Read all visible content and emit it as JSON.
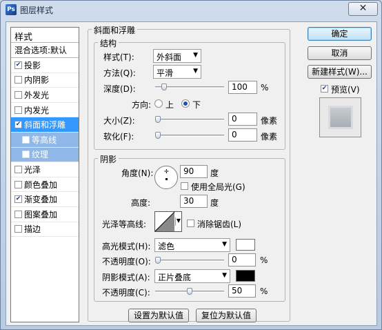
{
  "window": {
    "title": "图层样式",
    "close_symbol": "✕"
  },
  "style_list": {
    "header": "样式",
    "items": [
      {
        "label": "混合选项:默认",
        "checkbox": false,
        "checked": false,
        "state": "normal"
      },
      {
        "label": "投影",
        "checkbox": true,
        "checked": true,
        "state": "normal"
      },
      {
        "label": "内阴影",
        "checkbox": true,
        "checked": false,
        "state": "normal"
      },
      {
        "label": "外发光",
        "checkbox": true,
        "checked": false,
        "state": "normal"
      },
      {
        "label": "内发光",
        "checkbox": true,
        "checked": false,
        "state": "normal"
      },
      {
        "label": "斜面和浮雕",
        "checkbox": true,
        "checked": true,
        "state": "selected"
      },
      {
        "label": "等高线",
        "checkbox": true,
        "checked": false,
        "state": "sub"
      },
      {
        "label": "纹理",
        "checkbox": true,
        "checked": false,
        "state": "sub"
      },
      {
        "label": "光泽",
        "checkbox": true,
        "checked": false,
        "state": "normal"
      },
      {
        "label": "颜色叠加",
        "checkbox": true,
        "checked": false,
        "state": "normal"
      },
      {
        "label": "渐变叠加",
        "checkbox": true,
        "checked": true,
        "state": "normal"
      },
      {
        "label": "图案叠加",
        "checkbox": true,
        "checked": false,
        "state": "normal"
      },
      {
        "label": "描边",
        "checkbox": true,
        "checked": false,
        "state": "normal"
      }
    ]
  },
  "bevel": {
    "group_title": "斜面和浮雕",
    "structure": {
      "title": "结构",
      "style_label": "样式(T):",
      "style_value": "外斜面",
      "technique_label": "方法(Q):",
      "technique_value": "平滑",
      "depth_label": "深度(D):",
      "depth_value": "100",
      "depth_unit": "%",
      "depth_fraction": 0.1,
      "direction_label": "方向:",
      "dir_up": "上",
      "dir_down": "下",
      "direction_selected": "down",
      "size_label": "大小(Z):",
      "size_value": "0",
      "size_unit": "像素",
      "size_fraction": 0.0,
      "soften_label": "软化(F):",
      "soften_value": "0",
      "soften_unit": "像素",
      "soften_fraction": 0.0
    },
    "shading": {
      "title": "阴影",
      "angle_label": "角度(N):",
      "angle_value": "90",
      "angle_unit": "度",
      "global_light_label": "使用全局光(G)",
      "global_light_checked": false,
      "altitude_label": "高度:",
      "altitude_value": "30",
      "altitude_unit": "度",
      "gloss_contour_label": "光泽等高线:",
      "anti_aliased_label": "消除锯齿(L)",
      "anti_aliased_checked": false,
      "highlight_mode_label": "高光模式(H):",
      "highlight_mode_value": "滤色",
      "highlight_color": "#ffffff",
      "highlight_opacity_label": "不透明度(O):",
      "highlight_opacity_value": "0",
      "highlight_opacity_unit": "%",
      "highlight_opacity_fraction": 0.0,
      "shadow_mode_label": "阴影模式(A):",
      "shadow_mode_value": "正片叠底",
      "shadow_color": "#000000",
      "shadow_opacity_label": "不透明度(C):",
      "shadow_opacity_value": "50",
      "shadow_opacity_unit": "%",
      "shadow_opacity_fraction": 0.5
    },
    "set_default_label": "设置为默认值",
    "reset_default_label": "复位为默认值"
  },
  "side": {
    "ok_label": "确定",
    "cancel_label": "取消",
    "new_style_label": "新建样式(W)...",
    "preview_label": "预览(V)",
    "preview_checked": true
  }
}
